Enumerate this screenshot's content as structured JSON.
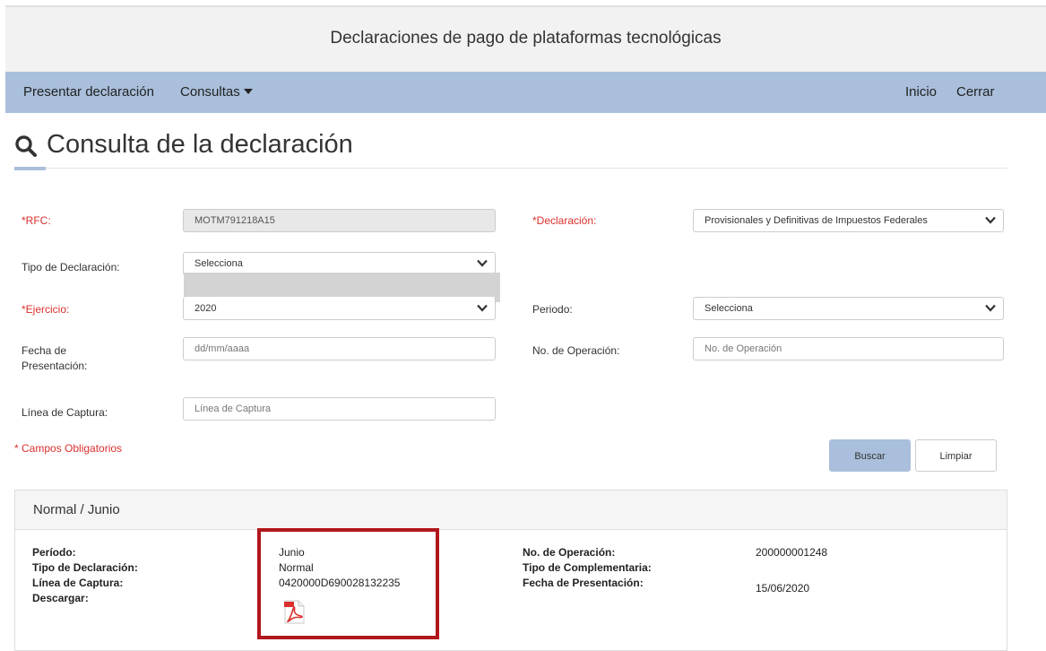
{
  "header": {
    "title": "Declaraciones de pago de plataformas tecnológicas"
  },
  "nav": {
    "present": "Presentar declaración",
    "queries": "Consultas",
    "home": "Inicio",
    "close": "Cerrar"
  },
  "page": {
    "title": "Consulta de la declaración"
  },
  "form": {
    "rfc_label": "*RFC:",
    "rfc_value": "MOTM791218A15",
    "declaracion_label": "*Declaración:",
    "declaracion_value": "Provisionales y Definitivas de Impuestos Federales",
    "tipo_label": "Tipo de Declaración:",
    "tipo_value": "Selecciona",
    "ejercicio_label": "*Ejercicio:",
    "ejercicio_value": "2020",
    "periodo_label": "Periodo:",
    "periodo_value": "Selecciona",
    "fecha_label_1": "Fecha de",
    "fecha_label_2": "Presentación:",
    "fecha_placeholder": "dd/mm/aaaa",
    "operacion_label": "No. de Operación:",
    "operacion_placeholder": "No. de Operación",
    "linea_label": "Línea de Captura:",
    "linea_placeholder": "Línea de Captura",
    "required_note": "* Campos Obligatorios",
    "search_button": "Buscar",
    "clear_button": "Limpiar"
  },
  "result": {
    "heading": "Normal / Junio",
    "periodo_label": "Período:",
    "periodo_value": "Junio",
    "tipo_label": "Tipo de Declaración:",
    "tipo_value": "Normal",
    "linea_label": "Línea de Captura:",
    "linea_value": "0420000D690028132235",
    "descargar_label": "Descargar:",
    "operacion_label": "No. de Operación:",
    "operacion_value": "200000001248",
    "complementaria_label": "Tipo de Complementaria:",
    "fecha_label": "Fecha de Presentación:",
    "fecha_value": "15/06/2020"
  },
  "icons": {
    "search": "search-icon",
    "download": "pdf-icon",
    "dropdown": "chevron-down-icon"
  },
  "colors": {
    "nav": "#a9bfdb",
    "required": "#d9302c",
    "highlight": "#b1171c"
  }
}
